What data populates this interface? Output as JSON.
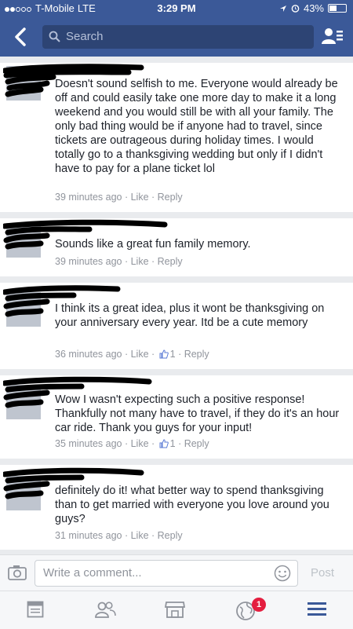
{
  "status_bar": {
    "carrier": "T-Mobile",
    "network": "LTE",
    "time": "3:29 PM",
    "battery": "43%",
    "battery_level": 0.43
  },
  "nav": {
    "search_placeholder": "Search"
  },
  "comments": [
    {
      "text": "Doesn't sound selfish to me. Everyone would already be off and could easily take one more day to make it a long weekend and you would still be with all your family. The only bad thing would be if anyone had to travel, since tickets are outrageous during holiday times. I would totally go to a thanksgiving wedding but only if I didn't have to pay for a plane ticket lol",
      "time": "39 minutes ago",
      "like": "Like",
      "reply": "Reply"
    },
    {
      "text": "Sounds like a great fun family memory.",
      "time": "39 minutes ago",
      "like": "Like",
      "reply": "Reply"
    },
    {
      "text": "I think its a great idea, plus it wont be thanksgiving on your anniversary every year. Itd be a cute memory",
      "time": "36 minutes ago",
      "like": "Like",
      "likes": "1",
      "reply": "Reply"
    },
    {
      "text": "Wow I wasn't expecting such a positive response! Thankfully not many have to travel, if they do it's an hour car ride. Thank you guys for your input!",
      "time": "35 minutes ago",
      "like": "Like",
      "likes": "1",
      "reply": "Reply"
    },
    {
      "text": "definitely do it! what better way to spend thanksgiving than to get married with everyone you love around you guys?",
      "time": "31 minutes ago",
      "like": "Like",
      "reply": "Reply"
    }
  ],
  "composer": {
    "placeholder": "Write a comment...",
    "post_label": "Post"
  },
  "tabbar": {
    "notifications_badge": "1"
  },
  "colors": {
    "brand": "#3b5998",
    "meta": "#90949c",
    "badge": "#e41e3f"
  }
}
